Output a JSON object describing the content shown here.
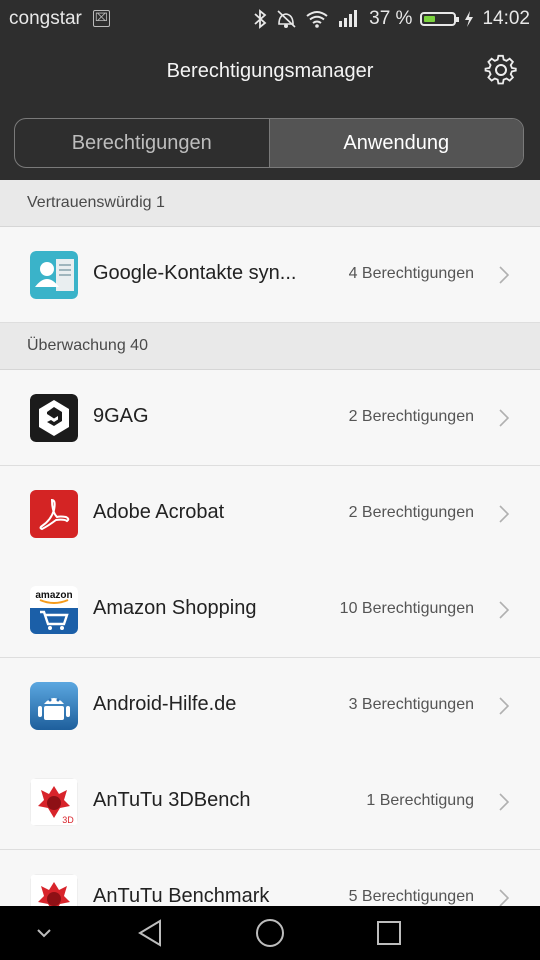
{
  "status_bar": {
    "carrier": "congstar",
    "battery_percent_label": "37 %",
    "battery_level": 0.37,
    "time": "14:02",
    "icons": [
      "sim-icon",
      "bluetooth-icon",
      "vibrate-off-icon",
      "wifi-icon",
      "signal-icon",
      "battery-icon",
      "charging-icon"
    ],
    "battery_color": "#7bd23e"
  },
  "header": {
    "title": "Berechtigungsmanager",
    "settings_icon": "gear-icon"
  },
  "tabs": [
    {
      "label": "Berechtigungen",
      "active": false
    },
    {
      "label": "Anwendung",
      "active": true
    }
  ],
  "sections": [
    {
      "title": "Vertrauenswürdig 1",
      "apps": [
        {
          "name": "Google-Kontakte syn...",
          "permissions": "4 Berechtigungen",
          "icon": "google-contacts-icon"
        }
      ]
    },
    {
      "title": "Überwachung 40",
      "apps": [
        {
          "name": "9GAG",
          "permissions": "2 Berechtigungen",
          "icon": "9gag-icon"
        },
        {
          "name": "Adobe Acrobat",
          "permissions": "2 Berechtigungen",
          "icon": "adobe-acrobat-icon"
        },
        {
          "name": "Amazon Shopping",
          "permissions": "10 Berechtigungen",
          "icon": "amazon-icon"
        },
        {
          "name": "Android-Hilfe.de",
          "permissions": "3 Berechtigungen",
          "icon": "android-hilfe-icon"
        },
        {
          "name": "AnTuTu 3DBench",
          "permissions": "1 Berechtigung",
          "icon": "antutu-3dbench-icon"
        },
        {
          "name": "AnTuTu Benchmark",
          "permissions": "5 Berechtigungen",
          "icon": "antutu-benchmark-icon"
        }
      ]
    }
  ],
  "amazon_icon_text": "amazon",
  "antutu_icon_text": "3D",
  "navigation_bar": [
    "collapse-icon",
    "back-icon",
    "home-icon",
    "recents-icon"
  ]
}
